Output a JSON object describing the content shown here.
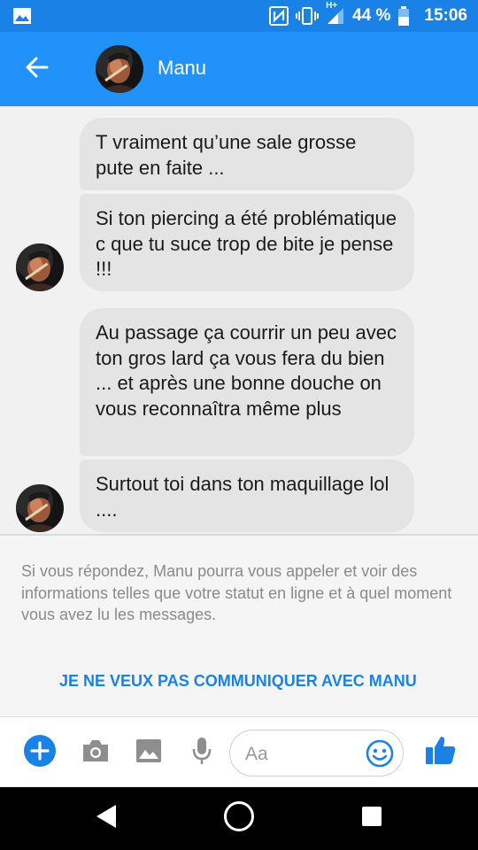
{
  "status_bar": {
    "battery": "44 %",
    "time": "15:06",
    "network_label": "H+"
  },
  "header": {
    "contact_name": "Manu"
  },
  "messages": [
    {
      "text": "T vraiment qu’une sale grosse pute en faite ..."
    },
    {
      "text": "Si ton piercing a été problématique c que tu suce trop de bite je pense !!!"
    },
    {
      "text": "Au passage ça courrir un peu avec ton gros lard ça vous fera du bien ... et après une bonne douche on vous reconnaîtra même plus"
    },
    {
      "text": "Surtout toi dans ton maquillage lol ...."
    }
  ],
  "notice": {
    "text": "Si vous répondez, Manu pourra vous appeler et voir des informations telles que votre statut en ligne et à quel moment vous avez lu les messages.",
    "block_link": "JE NE VEUX PAS COMMUNIQUER AVEC MANU"
  },
  "composer": {
    "placeholder": "Aa"
  },
  "colors": {
    "brand_blue": "#2092f9",
    "status_blue": "#1a82e6",
    "bubble_gray": "#e4e4e4"
  },
  "icons": {
    "status": [
      "image-icon",
      "nfc-icon",
      "vibrate-icon",
      "signal-icon",
      "battery-icon"
    ],
    "composer": [
      "plus-icon",
      "camera-icon",
      "gallery-icon",
      "microphone-icon",
      "emoji-icon",
      "thumbs-up-icon"
    ],
    "navigation": [
      "back-triangle-icon",
      "home-circle-icon",
      "recents-square-icon"
    ]
  }
}
